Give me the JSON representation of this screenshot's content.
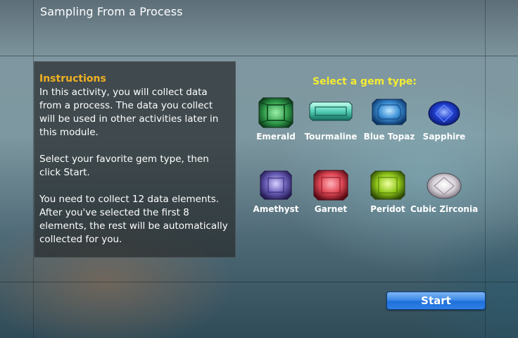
{
  "app": {
    "title": "Sampling From a Process"
  },
  "instructions": {
    "heading": "Instructions",
    "p1": "In this activity, you will collect data from a process.  The data you collect will be used in other activities later in this module.",
    "p2": "Select your favorite gem type, then click Start.",
    "p3": "You need to collect 12 data elements. After you've selected the first 8 elements, the rest will be automatically collected for you."
  },
  "gem_selector": {
    "heading": "Select a gem type:",
    "gems": [
      {
        "label": "Emerald",
        "icon": "emerald-gem-icon",
        "color": "#2f9a4a"
      },
      {
        "label": "Tourmaline",
        "icon": "tourmaline-gem-icon",
        "color": "#55d0b8"
      },
      {
        "label": "Blue Topaz",
        "icon": "blue-topaz-gem-icon",
        "color": "#3c8fd6"
      },
      {
        "label": "Sapphire",
        "icon": "sapphire-gem-icon",
        "color": "#1f3fcf"
      },
      {
        "label": "Amethyst",
        "icon": "amethyst-gem-icon",
        "color": "#6a5fb8"
      },
      {
        "label": "Garnet",
        "icon": "garnet-gem-icon",
        "color": "#e04855"
      },
      {
        "label": "Peridot",
        "icon": "peridot-gem-icon",
        "color": "#8fc81a"
      },
      {
        "label": "Cubic Zirconia",
        "icon": "cubic-zirconia-gem-icon",
        "color": "#d6d0d8"
      }
    ]
  },
  "actions": {
    "start_label": "Start"
  }
}
